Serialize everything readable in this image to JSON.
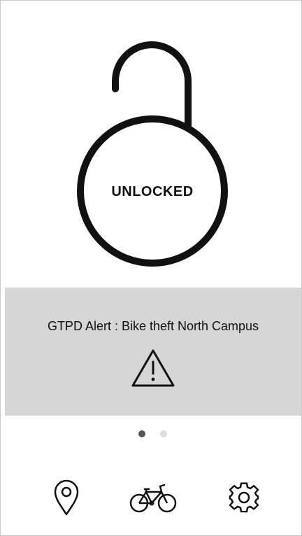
{
  "lock": {
    "status": "UNLOCKED"
  },
  "alert": {
    "text": "GTPD Alert : Bike theft North Campus",
    "icon": "warning-icon"
  },
  "pager": {
    "pages": 2,
    "active_page": 1
  },
  "tabbar": {
    "items": [
      {
        "icon": "map-pin-icon"
      },
      {
        "icon": "bicycle-icon"
      },
      {
        "icon": "gear-icon"
      }
    ]
  },
  "colors": {
    "background": "#ffffff",
    "banner": "#d6d6d6",
    "stroke": "#111111",
    "dot_active": "#555555",
    "dot_inactive": "#dddddd"
  }
}
